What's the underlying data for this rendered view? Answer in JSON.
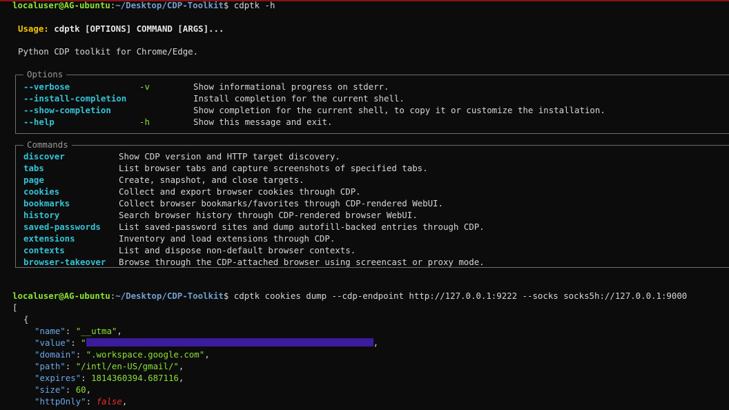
{
  "prompt1": {
    "user_host": "localuser@AG-ubuntu",
    "path": "~/Desktop/CDP-Toolkit",
    "command": "cdptk -h"
  },
  "usage": {
    "label": "Usage:",
    "text": "cdptk [OPTIONS] COMMAND [ARGS]..."
  },
  "description": "Python CDP toolkit for Chrome/Edge.",
  "options_title": "Options",
  "options": [
    {
      "flag": "--verbose",
      "short": "-v",
      "desc": "Show informational progress on stderr."
    },
    {
      "flag": "--install-completion",
      "short": "",
      "desc": "Install completion for the current shell."
    },
    {
      "flag": "--show-completion",
      "short": "",
      "desc": "Show completion for the current shell, to copy it or customize the installation."
    },
    {
      "flag": "--help",
      "short": "-h",
      "desc": "Show this message and exit."
    }
  ],
  "commands_title": "Commands",
  "commands": [
    {
      "name": "discover",
      "desc": "Show CDP version and HTTP target discovery."
    },
    {
      "name": "tabs",
      "desc": "List browser tabs and capture screenshots of specified tabs."
    },
    {
      "name": "page",
      "desc": "Create, snapshot, and close targets."
    },
    {
      "name": "cookies",
      "desc": "Collect and export browser cookies through CDP."
    },
    {
      "name": "bookmarks",
      "desc": "Collect browser bookmarks/favorites through CDP-rendered WebUI."
    },
    {
      "name": "history",
      "desc": "Search browser history through CDP-rendered browser WebUI."
    },
    {
      "name": "saved-passwords",
      "desc": "List saved-password sites and dump autofill-backed entries through CDP."
    },
    {
      "name": "extensions",
      "desc": "Inventory and load extensions through CDP."
    },
    {
      "name": "contexts",
      "desc": "List and dispose non-default browser contexts."
    },
    {
      "name": "browser-takeover",
      "desc": "Browse through the CDP-attached browser using screencast or proxy mode."
    }
  ],
  "prompt2": {
    "user_host": "localuser@AG-ubuntu",
    "path": "~/Desktop/CDP-Toolkit",
    "command": "cdptk cookies dump --cdp-endpoint http://127.0.0.1:9222 --socks socks5h://127.0.0.1:9000"
  },
  "json_output": {
    "open_bracket": "[",
    "open_brace": "{",
    "fields": [
      {
        "key": "\"name\"",
        "value": "\"__utma\"",
        "kind": "str"
      },
      {
        "key": "\"value\"",
        "value": "\"",
        "kind": "redacted"
      },
      {
        "key": "\"domain\"",
        "value": "\".workspace.google.com\"",
        "kind": "str"
      },
      {
        "key": "\"path\"",
        "value": "\"/intl/en-US/gmail/\"",
        "kind": "str"
      },
      {
        "key": "\"expires\"",
        "value": "1814360394.687116",
        "kind": "num"
      },
      {
        "key": "\"size\"",
        "value": "60",
        "kind": "num"
      },
      {
        "key": "\"httpOnly\"",
        "value": "false",
        "kind": "bool"
      }
    ]
  },
  "colors": {
    "background": "#0c0c0c",
    "prompt_user": "#8ae234",
    "prompt_path": "#729fcf",
    "usage_label": "#f5c400",
    "option_flag": "#34c2d6",
    "json_key": "#6aa7e8",
    "json_string": "#8ae234",
    "json_bool": "#ef2929",
    "redaction": "#3b1c9a"
  }
}
